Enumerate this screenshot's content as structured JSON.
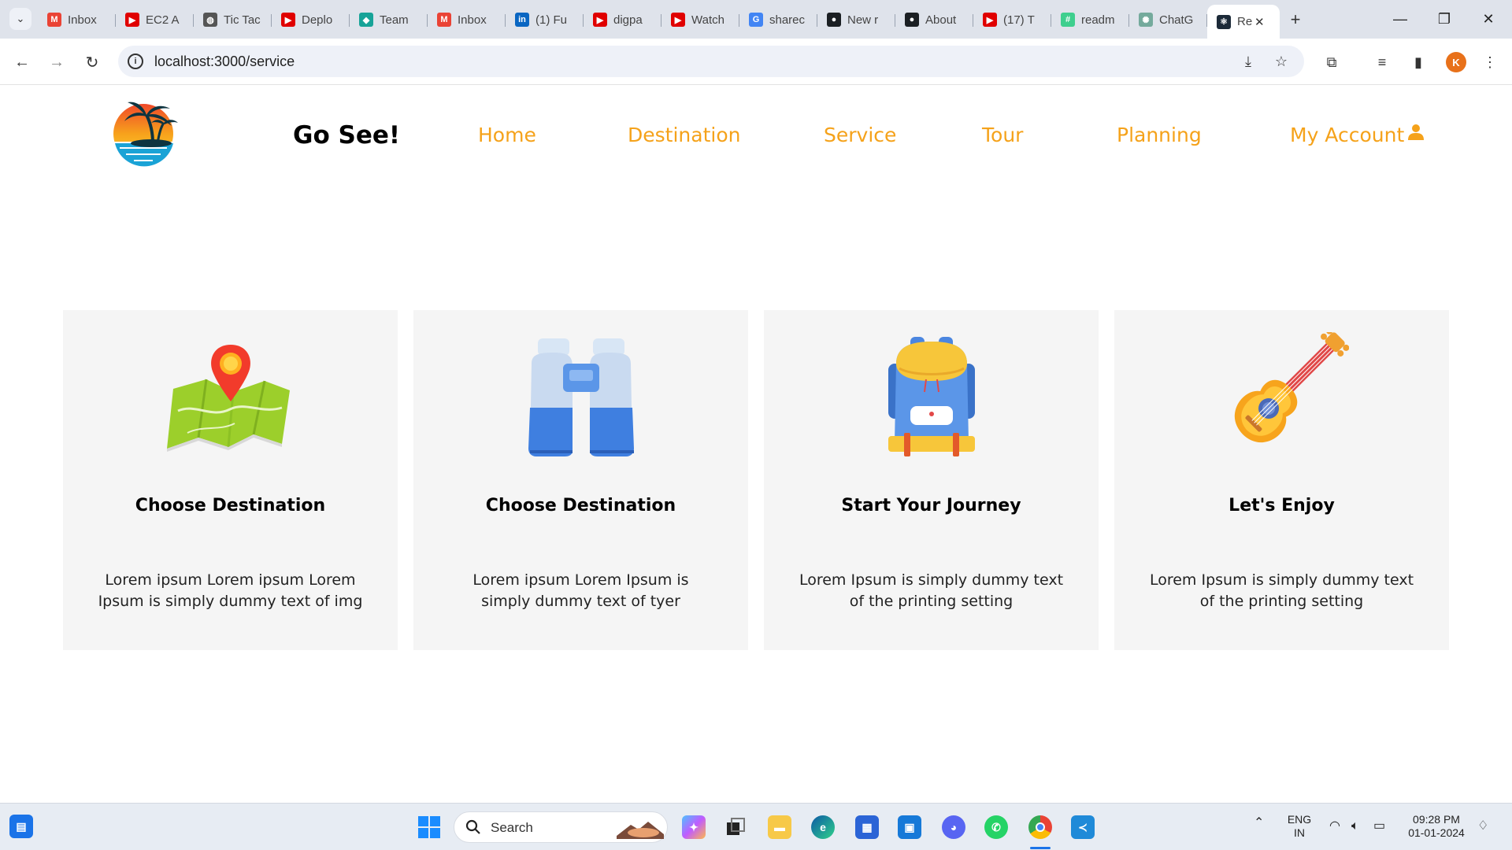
{
  "browser": {
    "tabs": [
      {
        "title": "Inbox",
        "icon": "gmail-icon",
        "color": "#ea4335",
        "glyph": "M"
      },
      {
        "title": "EC2 A",
        "icon": "youtube-icon",
        "color": "#e00000",
        "glyph": "▶"
      },
      {
        "title": "Tic Tac",
        "icon": "globe-icon",
        "color": "#555555",
        "glyph": "◍"
      },
      {
        "title": "Deplo",
        "icon": "youtube-icon",
        "color": "#e00000",
        "glyph": "▶"
      },
      {
        "title": "Team",
        "icon": "diamond-icon",
        "color": "#17a398",
        "glyph": "◆"
      },
      {
        "title": "Inbox",
        "icon": "gmail-icon",
        "color": "#ea4335",
        "glyph": "M"
      },
      {
        "title": "(1) Fu",
        "icon": "linkedin-icon",
        "color": "#0a66c2",
        "glyph": "in"
      },
      {
        "title": "digpa",
        "icon": "youtube-icon",
        "color": "#e00000",
        "glyph": "▶"
      },
      {
        "title": "Watch",
        "icon": "youtube-icon",
        "color": "#e00000",
        "glyph": "▶"
      },
      {
        "title": "sharec",
        "icon": "google-icon",
        "color": "#4285f4",
        "glyph": "G"
      },
      {
        "title": "New r",
        "icon": "github-icon",
        "color": "#1b1f23",
        "glyph": "●"
      },
      {
        "title": "About",
        "icon": "github-icon",
        "color": "#1b1f23",
        "glyph": "●"
      },
      {
        "title": "(17) T",
        "icon": "youtube-icon",
        "color": "#e00000",
        "glyph": "▶"
      },
      {
        "title": "readm",
        "icon": "chatbot-icon",
        "color": "#3ecf8e",
        "glyph": "#"
      },
      {
        "title": "ChatG",
        "icon": "openai-icon",
        "color": "#74aa9c",
        "glyph": "✺"
      }
    ],
    "active_tab": {
      "title": "Re",
      "icon": "react-icon",
      "color": "#1c2a38",
      "glyph": "⚛"
    },
    "url": "localhost:3000/service"
  },
  "site": {
    "brand": "Go See!",
    "nav": {
      "home": "Home",
      "destination": "Destination",
      "service": "Service",
      "tour": "Tour",
      "planning": "Planning",
      "account": "My Account"
    },
    "accent_color": "#f5a21a",
    "cards": [
      {
        "title": "Choose Destination",
        "desc": "Lorem ipsum Lorem ipsum Lorem Ipsum is simply dummy text of img",
        "icon": "map-pin-icon"
      },
      {
        "title": "Choose Destination",
        "desc": "Lorem ipsum Lorem Ipsum is simply dummy text of tyer",
        "icon": "binoculars-icon"
      },
      {
        "title": "Start Your Journey",
        "desc": "Lorem Ipsum is simply dummy text of the printing setting",
        "icon": "backpack-icon"
      },
      {
        "title": "Let's Enjoy",
        "desc": "Lorem Ipsum is simply dummy text of the printing setting",
        "icon": "guitar-icon"
      }
    ]
  },
  "taskbar": {
    "search_placeholder": "Search",
    "lang_top": "ENG",
    "lang_bottom": "IN",
    "time": "09:28 PM",
    "date": "01-01-2024",
    "profile_initial": "K"
  }
}
